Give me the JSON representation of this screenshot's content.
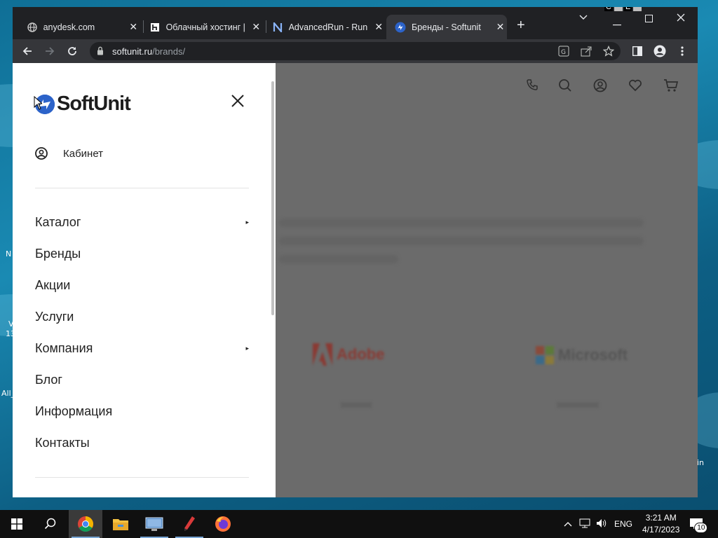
{
  "browser": {
    "tabs": [
      {
        "title": "anydesk.com",
        "icon": "globe-icon",
        "active": false
      },
      {
        "title": "Облачный хостинг |",
        "icon": "hosting-icon",
        "active": false
      },
      {
        "title": "AdvancedRun - Run",
        "icon": "n-logo-icon",
        "active": false
      },
      {
        "title": "Бренды - Softunit",
        "icon": "softunit-icon",
        "active": true
      }
    ],
    "close_symbol": "✕",
    "new_tab_symbol": "+",
    "url_host": "softunit.ru",
    "url_path": "/brands/",
    "overlay_letters": [
      "C",
      "E"
    ]
  },
  "drawer": {
    "logo_text": "SoftUnit",
    "cabinet_label": "Кабинет",
    "menu": [
      {
        "label": "Каталог",
        "has_submenu": true
      },
      {
        "label": "Бренды",
        "has_submenu": false
      },
      {
        "label": "Акции",
        "has_submenu": false
      },
      {
        "label": "Услуги",
        "has_submenu": false
      },
      {
        "label": "Компания",
        "has_submenu": true
      },
      {
        "label": "Блог",
        "has_submenu": false
      },
      {
        "label": "Информация",
        "has_submenu": false
      },
      {
        "label": "Контакты",
        "has_submenu": false
      }
    ],
    "submenu_arrow": "▸"
  },
  "page_bg": {
    "brands": [
      {
        "name": "Adobe",
        "color": "#c8463a"
      },
      {
        "name": "Microsoft",
        "color": "#7d7d7d"
      }
    ],
    "header_icons": [
      "phone-icon",
      "search-icon",
      "account-icon",
      "heart-icon",
      "cart-icon"
    ]
  },
  "taskbar": {
    "apps": [
      "chrome-icon",
      "file-explorer-icon",
      "remote-desktop-icon",
      "pen-app-icon",
      "firefox-icon"
    ],
    "language": "ENG",
    "time": "3:21 AM",
    "date": "4/17/2023",
    "notification_count": "10"
  },
  "desktop": {
    "fragments": [
      "N",
      "V",
      "13",
      "All_",
      "in"
    ]
  },
  "colors": {
    "accent": "#2c63c9",
    "chrome_dark": "#202124",
    "chrome_toolbar": "#35363a"
  }
}
